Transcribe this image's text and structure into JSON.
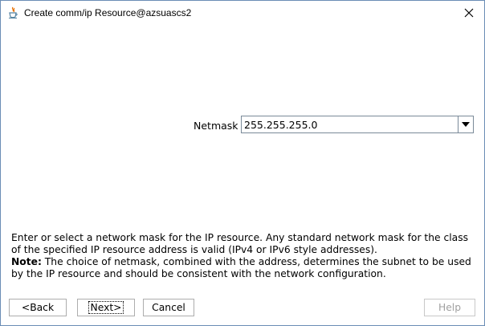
{
  "window": {
    "title": "Create comm/ip Resource@azsuascs2",
    "close_icon": "close-icon",
    "app_icon": "java-app-icon"
  },
  "form": {
    "netmask_label": "Netmask",
    "netmask_value": "255.255.255.0",
    "dropdown_icon": "chevron-down-icon"
  },
  "description": {
    "text": "Enter or select a network mask for the IP resource. Any standard network mask for the class of the specified IP resource address is valid (IPv4 or IPv6 style addresses).",
    "note_label": "Note:",
    "note_text": " The choice of netmask, combined with the address, determines the subnet to be used by the IP resource and should be consistent with the network configuration."
  },
  "buttons": {
    "back": "<Back",
    "next": "Next>",
    "cancel": "Cancel",
    "help": "Help"
  }
}
